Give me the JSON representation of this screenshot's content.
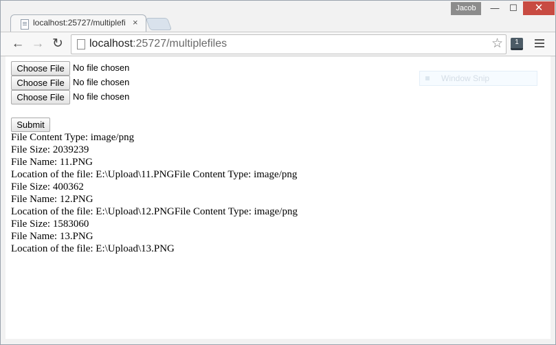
{
  "window": {
    "user_badge": "Jacob",
    "minimize_glyph": "—",
    "maximize_glyph": "☐",
    "close_glyph": "✕",
    "close_color": "#c84b42"
  },
  "tab": {
    "title": "localhost:25727/multiplefi",
    "close_glyph": "×"
  },
  "toolbar": {
    "back_glyph": "←",
    "forward_glyph": "→",
    "reload_glyph": "↻",
    "url_host": "localhost",
    "url_path": ":25727/multiplefiles",
    "star_glyph": "☆",
    "extension_badge": "1"
  },
  "form": {
    "file_inputs": [
      {
        "button": "Choose File",
        "status": "No file chosen"
      },
      {
        "button": "Choose File",
        "status": "No file chosen"
      },
      {
        "button": "Choose File",
        "status": "No file chosen"
      }
    ],
    "submit_label": "Submit"
  },
  "output_lines": [
    "File Content Type: image/png",
    "File Size: 2039239",
    "File Name: 11.PNG",
    "Location of the file: E:\\Upload\\11.PNGFile Content Type: image/png",
    "File Size: 400362",
    "File Name: 12.PNG",
    "Location of the file: E:\\Upload\\12.PNGFile Content Type: image/png",
    "File Size: 1583060",
    "File Name: 13.PNG",
    "Location of the file: E:\\Upload\\13.PNG"
  ],
  "overlay": {
    "snip_label": "Window Snip"
  }
}
